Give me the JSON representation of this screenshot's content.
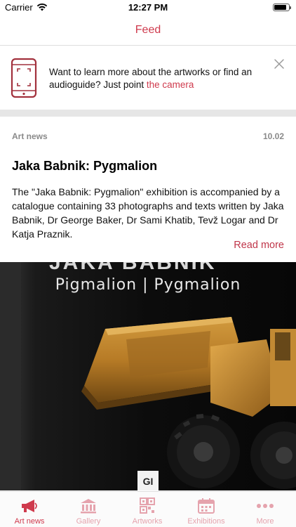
{
  "status_bar": {
    "carrier": "Carrier",
    "time": "12:27 PM",
    "battery_level": 0.85
  },
  "nav": {
    "title": "Feed"
  },
  "banner": {
    "text": "Want to learn more about the artworks or find an audioguide? Just point ",
    "link": "the camera",
    "icon": "phone-camera-icon",
    "close_icon": "close-icon"
  },
  "article": {
    "category": "Art news",
    "date": "10.02",
    "title": "Jaka Babnik: Pygmalion",
    "body": "The \"Jaka Babnik: Pygmalion\" exhibition is accompanied by a catalogue containing 33 photographs and texts written by Jaka Babnik, Dr George Baker, Dr Sami Khatib, Tevž Logar and Dr Katja Praznik.",
    "read_more": "Read more",
    "image": {
      "header_text": "JAKA BABNIK",
      "subtitle": "Pigmalion | Pygmalion",
      "logo_text": "GI"
    }
  },
  "tabs": [
    {
      "label": "Art news",
      "icon": "megaphone-icon",
      "active": true
    },
    {
      "label": "Gallery",
      "icon": "museum-icon",
      "active": false
    },
    {
      "label": "Artworks",
      "icon": "qr-grid-icon",
      "active": false
    },
    {
      "label": "Exhibitions",
      "icon": "calendar-icon",
      "active": false
    },
    {
      "label": "More",
      "icon": "more-dots-icon",
      "active": false
    }
  ],
  "colors": {
    "accent": "#cf3a4d",
    "accent_light": "#e5a3ad",
    "muted_text": "#8a8a8a"
  }
}
